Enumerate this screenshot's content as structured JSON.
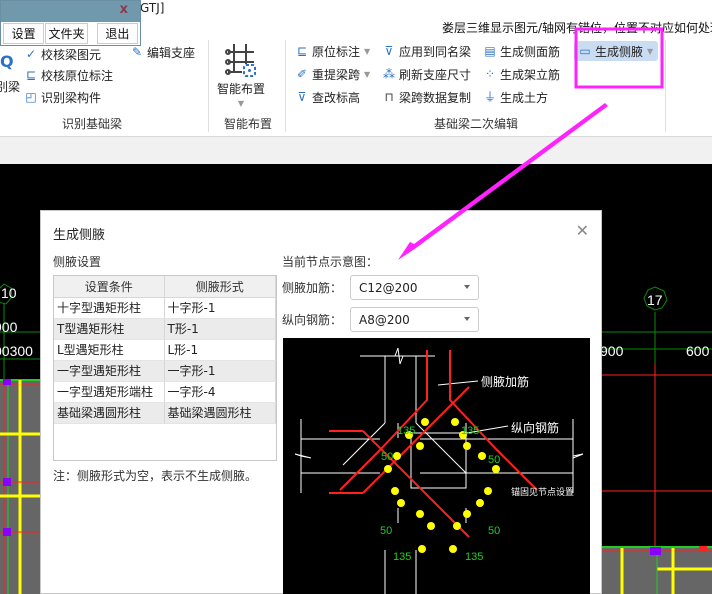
{
  "window": {
    "title_fragment": "GTJ]",
    "hint_text": "娄层三维显示图元/轴网有错位，位置不对应如何处理"
  },
  "mini_window": {
    "buttons": [
      "设置",
      "文件夹",
      "退出"
    ]
  },
  "ribbon": {
    "group_identify": {
      "label": "识别基础梁",
      "big_partial_label": "别梁",
      "items": [
        "校核梁图元",
        "校核原位标注",
        "识别梁构件",
        "编辑支座"
      ]
    },
    "group_smart": {
      "label": "智能布置",
      "button_label": "智能布置"
    },
    "group_edit": {
      "label": "基础梁二次编辑",
      "col1": [
        "原位标注",
        "重提梁跨",
        "查改标高"
      ],
      "col2": [
        "应用到同名梁",
        "刷新支座尺寸",
        "梁跨数据复制"
      ],
      "col3": [
        "生成侧面筋",
        "生成架立筋",
        "生成土方"
      ],
      "active": "生成侧腋"
    }
  },
  "cad": {
    "axis_left": "10",
    "axis_right": "17",
    "dim_left_1": "900",
    "dim_left_2": "00300",
    "dim_mid": "900",
    "dim_right": "600"
  },
  "dialog": {
    "title": "生成侧腋",
    "section_label": "侧腋设置",
    "table": {
      "headers": [
        "设置条件",
        "侧腋形式"
      ],
      "rows": [
        [
          "十字型遇矩形柱",
          "十字形-1"
        ],
        [
          "T型遇矩形柱",
          "T形-1"
        ],
        [
          "L型遇矩形柱",
          "L形-1"
        ],
        [
          "一字型遇矩形柱",
          "一字形-1"
        ],
        [
          "一字型遇矩形端柱",
          "一字形-4"
        ],
        [
          "基础梁遇圆形柱",
          "基础梁遇圆形柱"
        ]
      ]
    },
    "note": "注：侧腋形式为空，表示不生成侧腋。",
    "preview_label": "当前节点示意图：",
    "fields": {
      "haunch_rebar_label": "侧腋加筋：",
      "haunch_rebar_value": "C12@200",
      "long_rebar_label": "纵向钢筋：",
      "long_rebar_value": "A8@200"
    },
    "diagram": {
      "label_haunch": "侧腋加筋",
      "label_long": "纵向钢筋",
      "label_anchor": "锚固见节点设置",
      "angle": "135",
      "offset": "50"
    }
  },
  "colors": {
    "highlight_magenta": "#ff22ff",
    "rebar_red": "#ff2020",
    "dot_yellow": "#ffff00",
    "dim_green": "#22cc22",
    "ribbon_icon_blue": "#2b72c7",
    "active_bg": "#c9dcf2"
  }
}
